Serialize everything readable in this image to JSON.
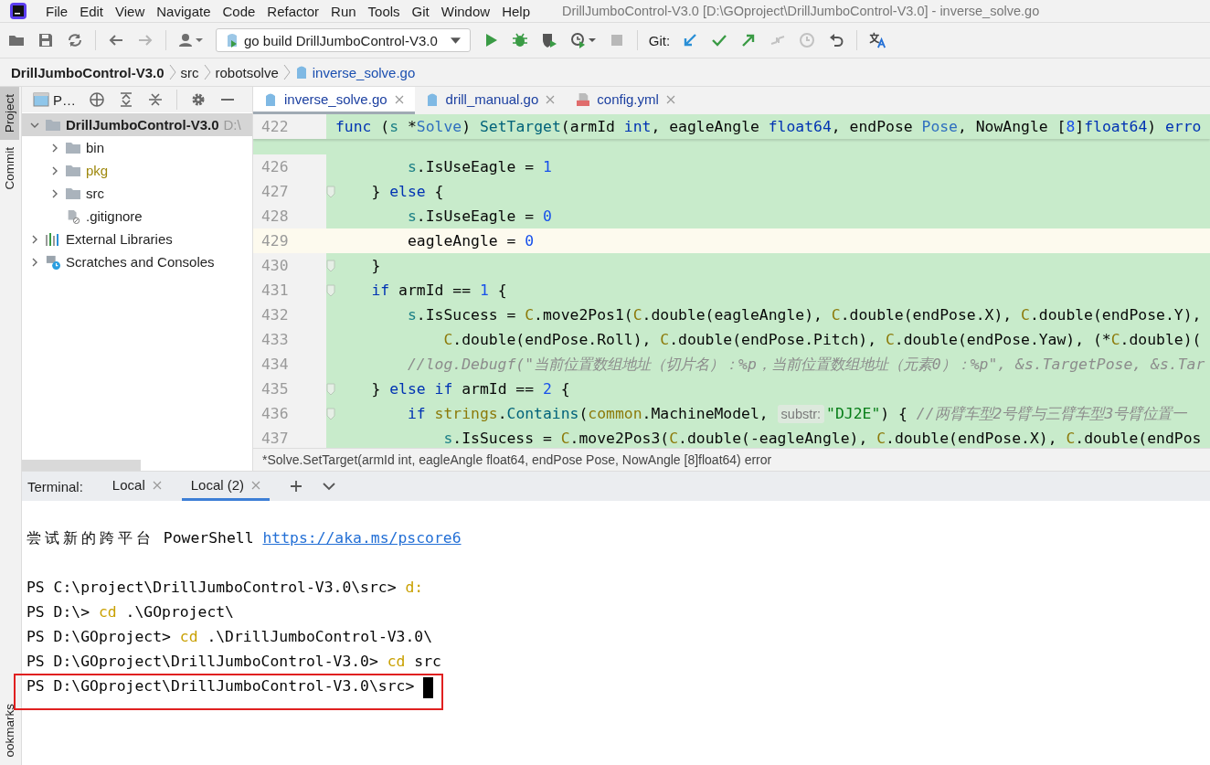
{
  "menu": {
    "items": [
      "File",
      "Edit",
      "View",
      "Navigate",
      "Code",
      "Refactor",
      "Run",
      "Tools",
      "Git",
      "Window",
      "Help"
    ],
    "title": "DrillJumboControl-V3.0 [D:\\GOproject\\DrillJumboControl-V3.0] - inverse_solve.go"
  },
  "toolbar": {
    "run_config": "go build DrillJumboControl-V3.0",
    "git_label": "Git:"
  },
  "breadcrumbs": [
    {
      "label": "DrillJumboControl-V3.0",
      "kind": "project"
    },
    {
      "label": "src",
      "kind": "folder"
    },
    {
      "label": "robotsolve",
      "kind": "folder"
    },
    {
      "label": "inverse_solve.go",
      "kind": "file"
    }
  ],
  "side_strip": {
    "top": [
      {
        "label": "Project",
        "selected": true
      },
      {
        "label": "Commit",
        "selected": false
      }
    ],
    "bottom": [
      {
        "label": "ookmarks",
        "selected": false
      }
    ]
  },
  "project_panel": {
    "title": "P…",
    "tree": [
      {
        "label": "DrillJumboControl-V3.0",
        "hint": "D:\\",
        "kind": "folder",
        "expanded": true,
        "selected": true,
        "children": [
          {
            "label": "bin",
            "kind": "folder",
            "expanded": false,
            "selected": false,
            "color": "#1f1f1f"
          },
          {
            "label": "pkg",
            "kind": "folder",
            "expanded": false,
            "selected": false,
            "color": "#9e880d"
          },
          {
            "label": "src",
            "kind": "folder",
            "expanded": false,
            "selected": false,
            "color": "#1f1f1f"
          },
          {
            "label": ".gitignore",
            "kind": "ignore",
            "selected": false,
            "color": "#1f1f1f"
          }
        ]
      },
      {
        "label": "External Libraries",
        "kind": "libraries",
        "expanded": false,
        "selected": false
      },
      {
        "label": "Scratches and Consoles",
        "kind": "scratches",
        "expanded": false,
        "selected": false
      }
    ]
  },
  "editor": {
    "tabs": [
      {
        "label": "inverse_solve.go",
        "kind": "go",
        "selected": true
      },
      {
        "label": "drill_manual.go",
        "kind": "go",
        "selected": false
      },
      {
        "label": "config.yml",
        "kind": "yml",
        "selected": false
      }
    ],
    "sticky": {
      "number": "422",
      "tokens": [
        {
          "kind": "k",
          "text": "func"
        },
        {
          "kind": "x",
          "text": " ("
        },
        {
          "kind": "r",
          "text": "s"
        },
        {
          "kind": "x",
          "text": " *"
        },
        {
          "kind": "t",
          "text": "Solve"
        },
        {
          "kind": "x",
          "text": ") "
        },
        {
          "kind": "f",
          "text": "SetTarget"
        },
        {
          "kind": "x",
          "text": "(armId "
        },
        {
          "kind": "k",
          "text": "int"
        },
        {
          "kind": "x",
          "text": ", eagleAngle "
        },
        {
          "kind": "k",
          "text": "float64"
        },
        {
          "kind": "x",
          "text": ", endPose "
        },
        {
          "kind": "t",
          "text": "Pose"
        },
        {
          "kind": "x",
          "text": ", NowAngle ["
        },
        {
          "kind": "n",
          "text": "8"
        },
        {
          "kind": "x",
          "text": "]"
        },
        {
          "kind": "k",
          "text": "float64"
        },
        {
          "kind": "x",
          "text": ") "
        },
        {
          "kind": "k",
          "text": "erro"
        }
      ]
    },
    "lines": [
      {
        "number": "426",
        "current": false,
        "fold": false,
        "tokens": [
          {
            "kind": "r",
            "text": "        s"
          },
          {
            "kind": "x",
            "text": ".IsUseEagle = "
          },
          {
            "kind": "n",
            "text": "1"
          }
        ]
      },
      {
        "number": "427",
        "current": false,
        "fold": true,
        "tokens": [
          {
            "kind": "x",
            "text": "    } "
          },
          {
            "kind": "k",
            "text": "else"
          },
          {
            "kind": "x",
            "text": " {"
          }
        ]
      },
      {
        "number": "428",
        "current": false,
        "fold": false,
        "tokens": [
          {
            "kind": "r",
            "text": "        s"
          },
          {
            "kind": "x",
            "text": ".IsUseEagle = "
          },
          {
            "kind": "n",
            "text": "0"
          }
        ]
      },
      {
        "number": "429",
        "current": true,
        "fold": false,
        "tokens": [
          {
            "kind": "x",
            "text": "        eagleAngle = "
          },
          {
            "kind": "n",
            "text": "0"
          }
        ]
      },
      {
        "number": "430",
        "current": false,
        "fold": true,
        "tokens": [
          {
            "kind": "x",
            "text": "    }"
          }
        ]
      },
      {
        "number": "431",
        "current": false,
        "fold": true,
        "tokens": [
          {
            "kind": "k",
            "text": "    if"
          },
          {
            "kind": "x",
            "text": " armId == "
          },
          {
            "kind": "n",
            "text": "1"
          },
          {
            "kind": "x",
            "text": " {"
          }
        ]
      },
      {
        "number": "432",
        "current": false,
        "fold": false,
        "tokens": [
          {
            "kind": "r",
            "text": "        s"
          },
          {
            "kind": "x",
            "text": ".IsSucess = "
          },
          {
            "kind": "p",
            "text": "C"
          },
          {
            "kind": "x",
            "text": ".move2Pos1("
          },
          {
            "kind": "p",
            "text": "C"
          },
          {
            "kind": "x",
            "text": ".double(eagleAngle), "
          },
          {
            "kind": "p",
            "text": "C"
          },
          {
            "kind": "x",
            "text": ".double(endPose.X), "
          },
          {
            "kind": "p",
            "text": "C"
          },
          {
            "kind": "x",
            "text": ".double(endPose.Y),"
          }
        ]
      },
      {
        "number": "433",
        "current": false,
        "fold": false,
        "tokens": [
          {
            "kind": "p",
            "text": "            C"
          },
          {
            "kind": "x",
            "text": ".double(endPose.Roll), "
          },
          {
            "kind": "p",
            "text": "C"
          },
          {
            "kind": "x",
            "text": ".double(endPose.Pitch), "
          },
          {
            "kind": "p",
            "text": "C"
          },
          {
            "kind": "x",
            "text": ".double(endPose.Yaw), (*"
          },
          {
            "kind": "p",
            "text": "C"
          },
          {
            "kind": "x",
            "text": ".double)("
          }
        ]
      },
      {
        "number": "434",
        "current": false,
        "fold": false,
        "tokens": [
          {
            "kind": "c",
            "text": "        //log.Debugf(\"当前位置数组地址（切片名）：%p，当前位置数组地址（元素0）：%p\", &s.TargetPose, &s.Tar"
          }
        ]
      },
      {
        "number": "435",
        "current": false,
        "fold": true,
        "tokens": [
          {
            "kind": "x",
            "text": "    } "
          },
          {
            "kind": "k",
            "text": "else if"
          },
          {
            "kind": "x",
            "text": " armId == "
          },
          {
            "kind": "n",
            "text": "2"
          },
          {
            "kind": "x",
            "text": " {"
          }
        ]
      },
      {
        "number": "436",
        "current": false,
        "fold": true,
        "tokens": [
          {
            "kind": "k",
            "text": "        if "
          },
          {
            "kind": "p",
            "text": "strings"
          },
          {
            "kind": "x",
            "text": "."
          },
          {
            "kind": "f",
            "text": "Contains"
          },
          {
            "kind": "x",
            "text": "("
          },
          {
            "kind": "p",
            "text": "common"
          },
          {
            "kind": "x",
            "text": ".MachineModel, "
          },
          {
            "kind": "h",
            "text": "substr:"
          },
          {
            "kind": "s",
            "text": "\"DJ2E\""
          },
          {
            "kind": "x",
            "text": ") { "
          },
          {
            "kind": "c",
            "text": "//两臂车型2号臂与三臂车型3号臂位置一"
          }
        ]
      },
      {
        "number": "437",
        "current": false,
        "fold": false,
        "tokens": [
          {
            "kind": "r",
            "text": "            s"
          },
          {
            "kind": "x",
            "text": ".IsSucess = "
          },
          {
            "kind": "p",
            "text": "C"
          },
          {
            "kind": "x",
            "text": ".move2Pos3("
          },
          {
            "kind": "p",
            "text": "C"
          },
          {
            "kind": "x",
            "text": ".double(-eagleAngle), "
          },
          {
            "kind": "p",
            "text": "C"
          },
          {
            "kind": "x",
            "text": ".double(endPose.X), "
          },
          {
            "kind": "p",
            "text": "C"
          },
          {
            "kind": "x",
            "text": ".double(endPos"
          }
        ]
      }
    ],
    "hint": "*Solve.SetTarget(armId int, eagleAngle float64, endPose Pose, NowAngle [8]float64) error"
  },
  "terminal": {
    "label": "Terminal:",
    "tabs": [
      {
        "label": "Local",
        "selected": false
      },
      {
        "label": "Local (2)",
        "selected": true
      }
    ],
    "lines": [
      {
        "boxed": false,
        "cursor": false,
        "tokens": [
          {
            "kind": "cjk",
            "text": "尝试新的跨平台"
          },
          {
            "kind": "x",
            "text": " PowerShell "
          }
        ],
        "link": "https://aka.ms/pscore6"
      },
      {
        "boxed": false,
        "cursor": false,
        "tokens": [
          {
            "kind": "x",
            "text": "PS C:\\project\\DrillJumboControl-V3.0\\src> "
          },
          {
            "kind": "y",
            "text": "d:"
          }
        ]
      },
      {
        "boxed": false,
        "cursor": false,
        "tokens": [
          {
            "kind": "x",
            "text": "PS D:\\> "
          },
          {
            "kind": "y",
            "text": "cd"
          },
          {
            "kind": "x",
            "text": " .\\GOproject\\"
          }
        ]
      },
      {
        "boxed": false,
        "cursor": false,
        "tokens": [
          {
            "kind": "x",
            "text": "PS D:\\GOproject> "
          },
          {
            "kind": "y",
            "text": "cd"
          },
          {
            "kind": "x",
            "text": " .\\DrillJumboControl-V3.0\\"
          }
        ]
      },
      {
        "boxed": false,
        "cursor": false,
        "tokens": [
          {
            "kind": "x",
            "text": "PS D:\\GOproject\\DrillJumboControl-V3.0> "
          },
          {
            "kind": "y",
            "text": "cd"
          },
          {
            "kind": "x",
            "text": " src"
          }
        ]
      },
      {
        "boxed": true,
        "cursor": true,
        "tokens": [
          {
            "kind": "x",
            "text": "PS D:\\GOproject\\DrillJumboControl-V3.0\\src> "
          }
        ]
      }
    ]
  }
}
